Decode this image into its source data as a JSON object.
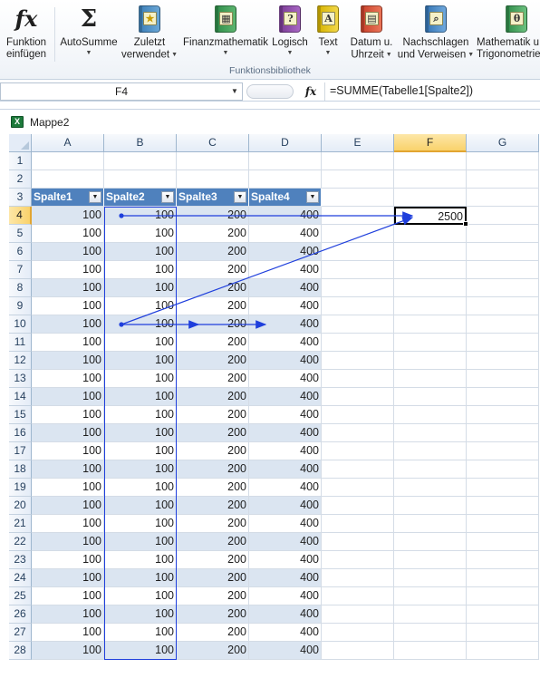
{
  "ribbon": {
    "group_label": "Funktionsbibliothek",
    "buttons": [
      {
        "id": "insert-function",
        "line1": "Funktion",
        "line2": "einfügen",
        "icon": "fx-icon",
        "dropdown": false
      },
      {
        "id": "autosum",
        "line1": "AutoSumme",
        "line2": "",
        "icon": "sigma-icon",
        "dropdown": true
      },
      {
        "id": "recently-used",
        "line1": "Zuletzt",
        "line2": "verwendet",
        "icon": "star-book-icon",
        "dropdown": true
      },
      {
        "id": "financial",
        "line1": "Finanzmathematik",
        "line2": "",
        "icon": "calculator-book-icon",
        "dropdown": true
      },
      {
        "id": "logical",
        "line1": "Logisch",
        "line2": "",
        "icon": "question-book-icon",
        "dropdown": true
      },
      {
        "id": "text",
        "line1": "Text",
        "line2": "",
        "icon": "text-book-icon",
        "dropdown": true
      },
      {
        "id": "date-time",
        "line1": "Datum u.",
        "line2": "Uhrzeit",
        "icon": "calendar-book-icon",
        "dropdown": true
      },
      {
        "id": "lookup-reference",
        "line1": "Nachschlagen",
        "line2": "und Verweisen",
        "icon": "magnifier-book-icon",
        "dropdown": true
      },
      {
        "id": "math-trig",
        "line1": "Mathematik u.",
        "line2": "Trigonometrie",
        "icon": "theta-book-icon",
        "dropdown": true
      }
    ],
    "icon_glyphs": {
      "fx": "fx",
      "sigma": "Σ",
      "star": "★",
      "calc": "▦",
      "question": "?",
      "text": "A",
      "date": "▤",
      "lookup": "⌕",
      "theta": "θ"
    }
  },
  "formula_bar": {
    "name_box": "F4",
    "fx_label": "fx",
    "formula": "=SUMME(Tabelle1[Spalte2])"
  },
  "workbook": {
    "title": "Mappe2",
    "icon_letter": "X"
  },
  "sheet": {
    "columns": [
      "A",
      "B",
      "C",
      "D",
      "E",
      "F",
      "G"
    ],
    "selected_column": "F",
    "selected_row": 4,
    "rows": [
      1,
      2,
      3,
      4,
      5,
      6,
      7,
      8,
      9,
      10,
      11,
      12,
      13,
      14,
      15,
      16,
      17,
      18,
      19,
      20,
      21,
      22,
      23,
      24,
      25,
      26,
      27,
      28
    ],
    "table": {
      "headers": [
        "Spalte1",
        "Spalte2",
        "Spalte3",
        "Spalte4"
      ],
      "header_row": 3,
      "values": [
        100,
        100,
        200,
        400
      ],
      "first_data_row": 4,
      "last_data_row": 28
    },
    "result_cell": {
      "ref": "F4",
      "value": "2500"
    }
  },
  "colors": {
    "table_header": "#4f81bd",
    "table_band": "#dbe5f1",
    "tracer_arrow": "#1f3fdc",
    "selected_header": "#f9d26b"
  }
}
